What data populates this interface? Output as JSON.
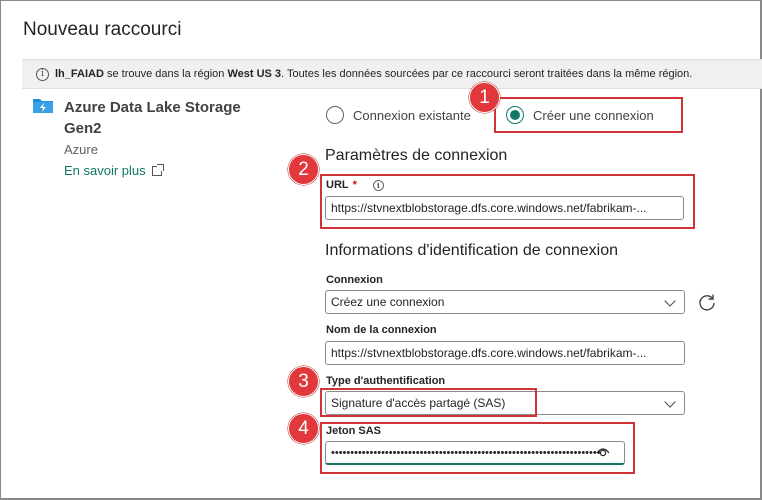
{
  "dialog": {
    "title": "Nouveau raccourci"
  },
  "banner": {
    "lakehouse": "lh_FAIAD",
    "part1": " se trouve dans la région ",
    "region": "West US 3",
    "part2": ". Toutes les données sourcées par ce raccourci seront traitées dans la même région."
  },
  "source": {
    "name": "Azure Data Lake Storage Gen2",
    "provider": "Azure",
    "learn_more": "En savoir plus"
  },
  "connection_mode": {
    "existing_label": "Connexion existante",
    "create_label": "Créer une connexion",
    "selected": "create"
  },
  "settings": {
    "heading": "Paramètres de connexion",
    "url_label": "URL",
    "url_required": "*",
    "url_value": "https://stvnextblobstorage.dfs.core.windows.net/fabrikam-..."
  },
  "credentials": {
    "heading": "Informations d'identification de connexion",
    "connection_label": "Connexion",
    "connection_value": "Créez une connexion",
    "name_label": "Nom de la connexion",
    "name_value": "https://stvnextblobstorage.dfs.core.windows.net/fabrikam-...",
    "auth_label": "Type d'authentification",
    "auth_value": "Signature d'accès partagé (SAS)",
    "sas_label": "Jeton SAS",
    "sas_value": "••••••••••••••••••••••••••••••••••••••••••••••••••••••••••••••••••••••"
  },
  "callouts": [
    "1",
    "2",
    "3",
    "4"
  ],
  "colors": {
    "accent": "#117865",
    "highlight": "#d13438",
    "badge": "#e0383b",
    "banner_bg": "#f0f0f0"
  },
  "icons": [
    "info-icon",
    "adls-icon",
    "external-link-icon",
    "chevron-down-icon",
    "refresh-icon",
    "eye-icon"
  ]
}
